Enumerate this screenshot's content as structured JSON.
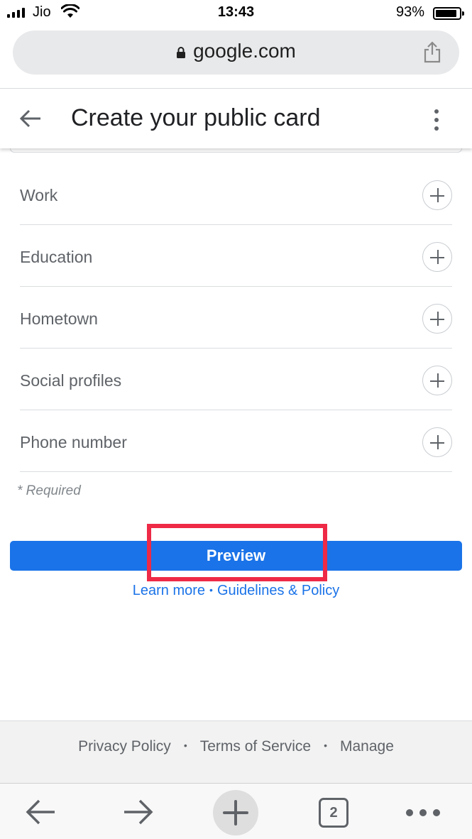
{
  "status_bar": {
    "carrier": "Jio",
    "time": "13:43",
    "battery_percent": "93%",
    "battery_level": 0.93
  },
  "browser": {
    "url": "google.com",
    "lock_icon": "lock-icon",
    "share_icon": "share-icon"
  },
  "header": {
    "title": "Create your public card",
    "back_icon": "arrow-left-icon",
    "menu_icon": "more-vert-icon"
  },
  "fields": [
    {
      "label": "Work",
      "icon": "add-circle-icon"
    },
    {
      "label": "Education",
      "icon": "add-circle-icon"
    },
    {
      "label": "Hometown",
      "icon": "add-circle-icon"
    },
    {
      "label": "Social profiles",
      "icon": "add-circle-icon"
    },
    {
      "label": "Phone number",
      "icon": "add-circle-icon"
    }
  ],
  "required_note": "* Required",
  "preview_label": "Preview",
  "highlight_color": "#ee2a46",
  "accent_color": "#1a73e8",
  "links": {
    "learn_more": "Learn more",
    "separator": "•",
    "guidelines": "Guidelines & Policy"
  },
  "footer": {
    "privacy": "Privacy Policy",
    "dot": "•",
    "terms": "Terms of Service",
    "manage": "Manage"
  },
  "toolbar": {
    "tab_count": "2",
    "icons": [
      "back-arrow-icon",
      "forward-arrow-icon",
      "new-tab-plus-icon",
      "tab-switcher-icon",
      "more-horiz-icon"
    ]
  }
}
